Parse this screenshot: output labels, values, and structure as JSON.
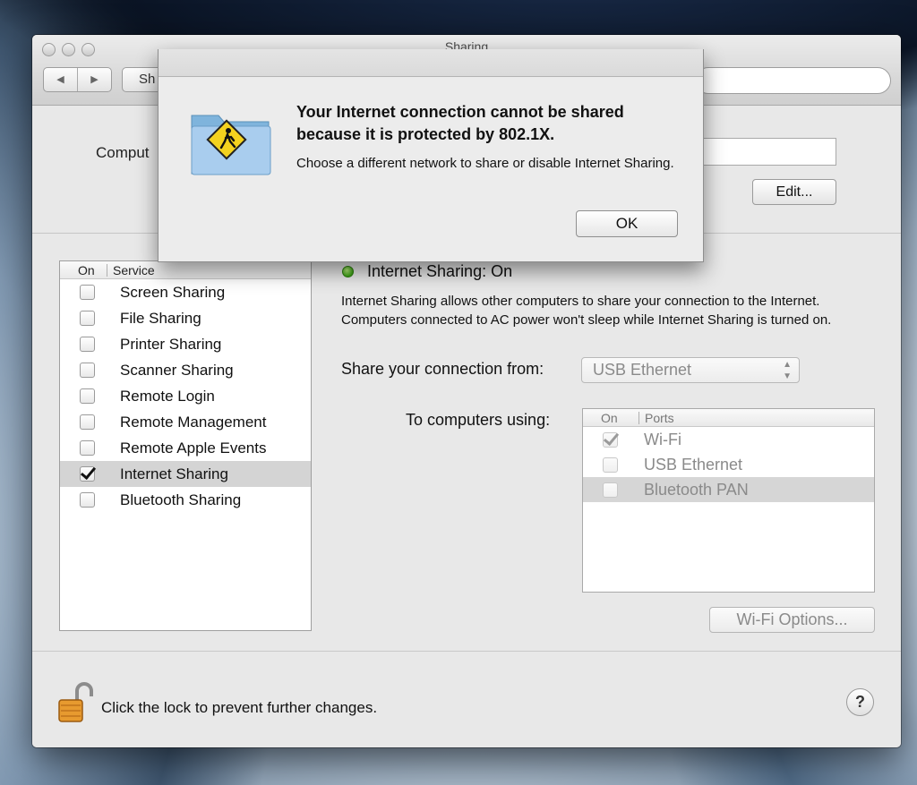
{
  "window": {
    "title": "Sharing",
    "nav_back": "◀",
    "nav_forward": "▶",
    "show_all_label": "Sh",
    "computer_name_label": "Comput",
    "edit_label": "Edit..."
  },
  "service_list": {
    "header_on": "On",
    "header_service": "Service",
    "items": [
      {
        "label": "Screen Sharing",
        "checked": false,
        "selected": false
      },
      {
        "label": "File Sharing",
        "checked": false,
        "selected": false
      },
      {
        "label": "Printer Sharing",
        "checked": false,
        "selected": false
      },
      {
        "label": "Scanner Sharing",
        "checked": false,
        "selected": false
      },
      {
        "label": "Remote Login",
        "checked": false,
        "selected": false
      },
      {
        "label": "Remote Management",
        "checked": false,
        "selected": false
      },
      {
        "label": "Remote Apple Events",
        "checked": false,
        "selected": false
      },
      {
        "label": "Internet Sharing",
        "checked": true,
        "selected": true
      },
      {
        "label": "Bluetooth Sharing",
        "checked": false,
        "selected": false
      }
    ]
  },
  "detail": {
    "status": "Internet Sharing: On",
    "status_color": "#3ba315",
    "description": "Internet Sharing allows other computers to share your connection to the Internet. Computers connected to AC power won't sleep while Internet Sharing is turned on.",
    "share_from_label": "Share your connection from:",
    "share_from_value": "USB Ethernet",
    "to_computers_label": "To computers using:",
    "ports_header_on": "On",
    "ports_header_ports": "Ports",
    "ports": [
      {
        "label": "Wi-Fi",
        "checked": true,
        "selected": false
      },
      {
        "label": "USB Ethernet",
        "checked": false,
        "selected": false
      },
      {
        "label": "Bluetooth PAN",
        "checked": false,
        "selected": true
      }
    ],
    "wifi_options_label": "Wi-Fi Options..."
  },
  "bottom": {
    "lock_text": "Click the lock to prevent further changes.",
    "help_label": "?"
  },
  "alert": {
    "title": "Your Internet connection cannot be shared because it is protected by 802.1X.",
    "message": "Choose a different network to share or disable Internet Sharing.",
    "ok_label": "OK",
    "icon": "folder-caution-icon"
  }
}
